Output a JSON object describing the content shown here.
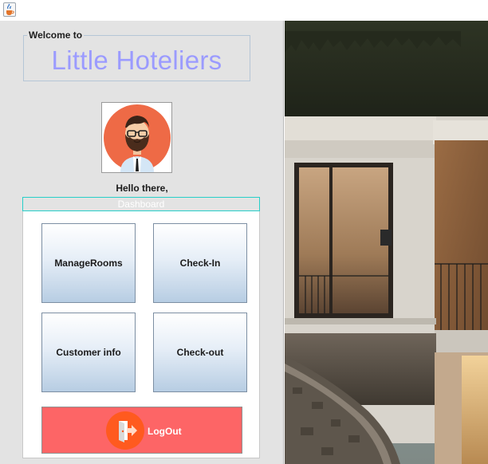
{
  "window": {
    "icon": "java-cup-icon"
  },
  "header": {
    "group_label": "Welcome to",
    "app_title": "Little Hoteliers"
  },
  "profile": {
    "avatar": "bearded-man-avatar",
    "greeting": "Hello there,"
  },
  "dashboard": {
    "title": "Dashboard",
    "buttons": {
      "manage_rooms": "ManageRooms",
      "check_in": "Check-In",
      "customer_info": "Customer info",
      "check_out": "Check-out"
    },
    "logout": {
      "label": "LogOut",
      "icon": "exit-door-icon"
    }
  },
  "colors": {
    "title": "#9b9bff",
    "dashboard_border": "#27cfc9",
    "logout_bg": "#fd6566",
    "logout_icon_bg": "#ff5a1f",
    "avatar_bg": "#ee6a46"
  }
}
